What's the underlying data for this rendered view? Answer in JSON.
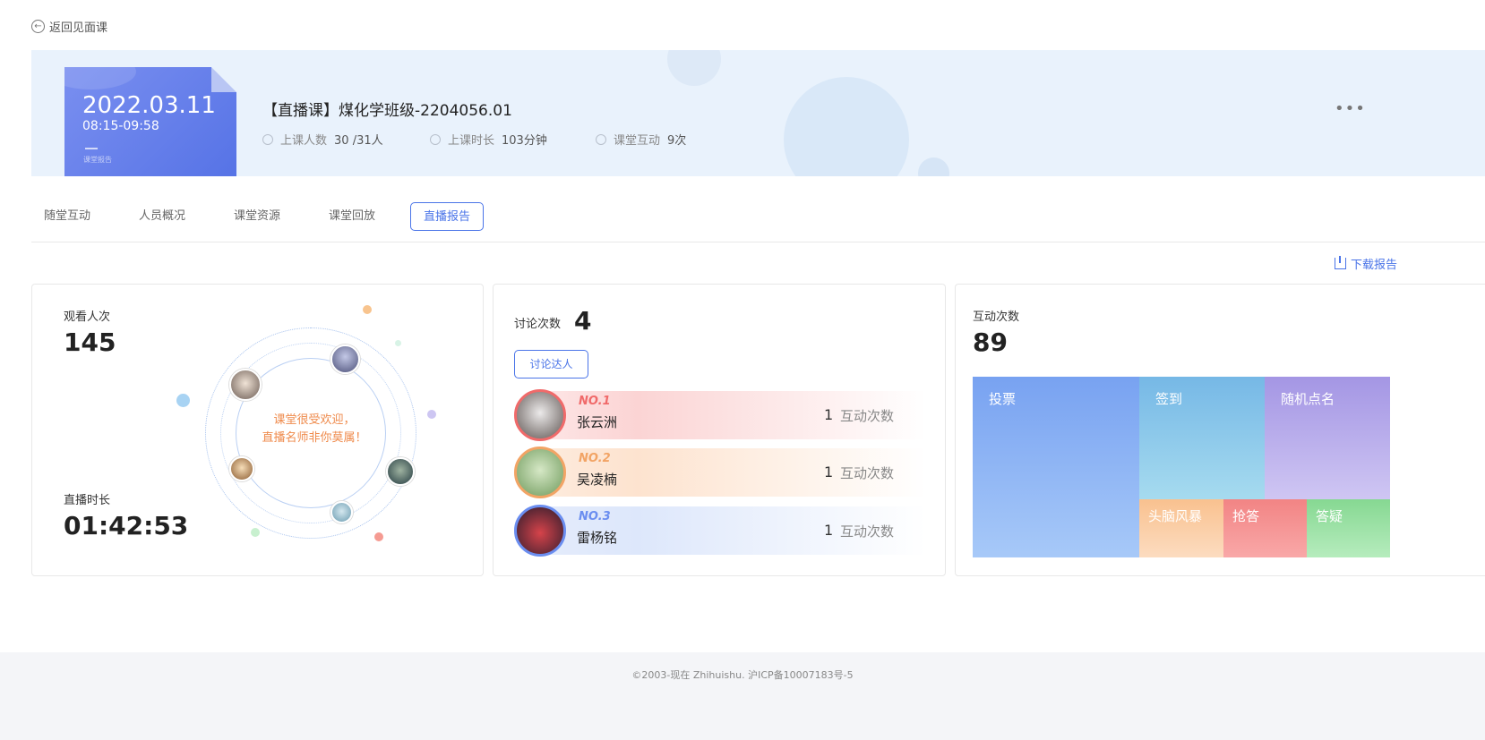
{
  "header": {
    "back_label": "返回见面课"
  },
  "banner": {
    "cover_date": "2022.03.11",
    "cover_time": "08:15-09:58",
    "cover_tag": "课堂报告",
    "title": "【直播课】煤化学班级-2204056.01",
    "attendance_label": "上课人数",
    "attendance_value": "30 /31人",
    "duration_label": "上课时长",
    "duration_value": "103分钟",
    "interaction_label": "课堂互动",
    "interaction_value": "9次",
    "more_label": "•••"
  },
  "tabs": [
    {
      "label": "随堂互动"
    },
    {
      "label": "人员概况"
    },
    {
      "label": "课堂资源"
    },
    {
      "label": "课堂回放"
    },
    {
      "label": "直播报告",
      "active": true
    }
  ],
  "download_label": "下载报告",
  "views_card": {
    "views_label": "观看人次",
    "views_value": "145",
    "duration_label": "直播时长",
    "duration_value": "01:42:53",
    "welcome_line1": "课堂很受欢迎，",
    "welcome_line2": "直播名师非你莫属！"
  },
  "discussion_card": {
    "label": "讨论次数",
    "value": "4",
    "button_label": "讨论达人",
    "ranks": [
      {
        "no": "NO.1",
        "name": "张云洲",
        "count": "1",
        "count_label": "互动次数",
        "color": "#f06a6a"
      },
      {
        "no": "NO.2",
        "name": "吴凌楠",
        "count": "1",
        "count_label": "互动次数",
        "color": "#f2a465"
      },
      {
        "no": "NO.3",
        "name": "雷杨铭",
        "count": "1",
        "count_label": "互动次数",
        "color": "#6b8ef0"
      }
    ]
  },
  "interaction_card": {
    "label": "互动次数",
    "value": "89",
    "treemap": [
      {
        "label": "投票",
        "color": "#7ea6f2"
      },
      {
        "label": "签到",
        "color": "#79bde5"
      },
      {
        "label": "随机点名",
        "color": "#a89ce6"
      },
      {
        "label": "头脑风暴",
        "color": "#f9c99e"
      },
      {
        "label": "抢答",
        "color": "#f48a8a"
      },
      {
        "label": "答疑",
        "color": "#8fdc9a"
      }
    ]
  },
  "footer": {
    "text": "©2003-现在 Zhihuishu. 沪ICP备10007183号-5"
  }
}
